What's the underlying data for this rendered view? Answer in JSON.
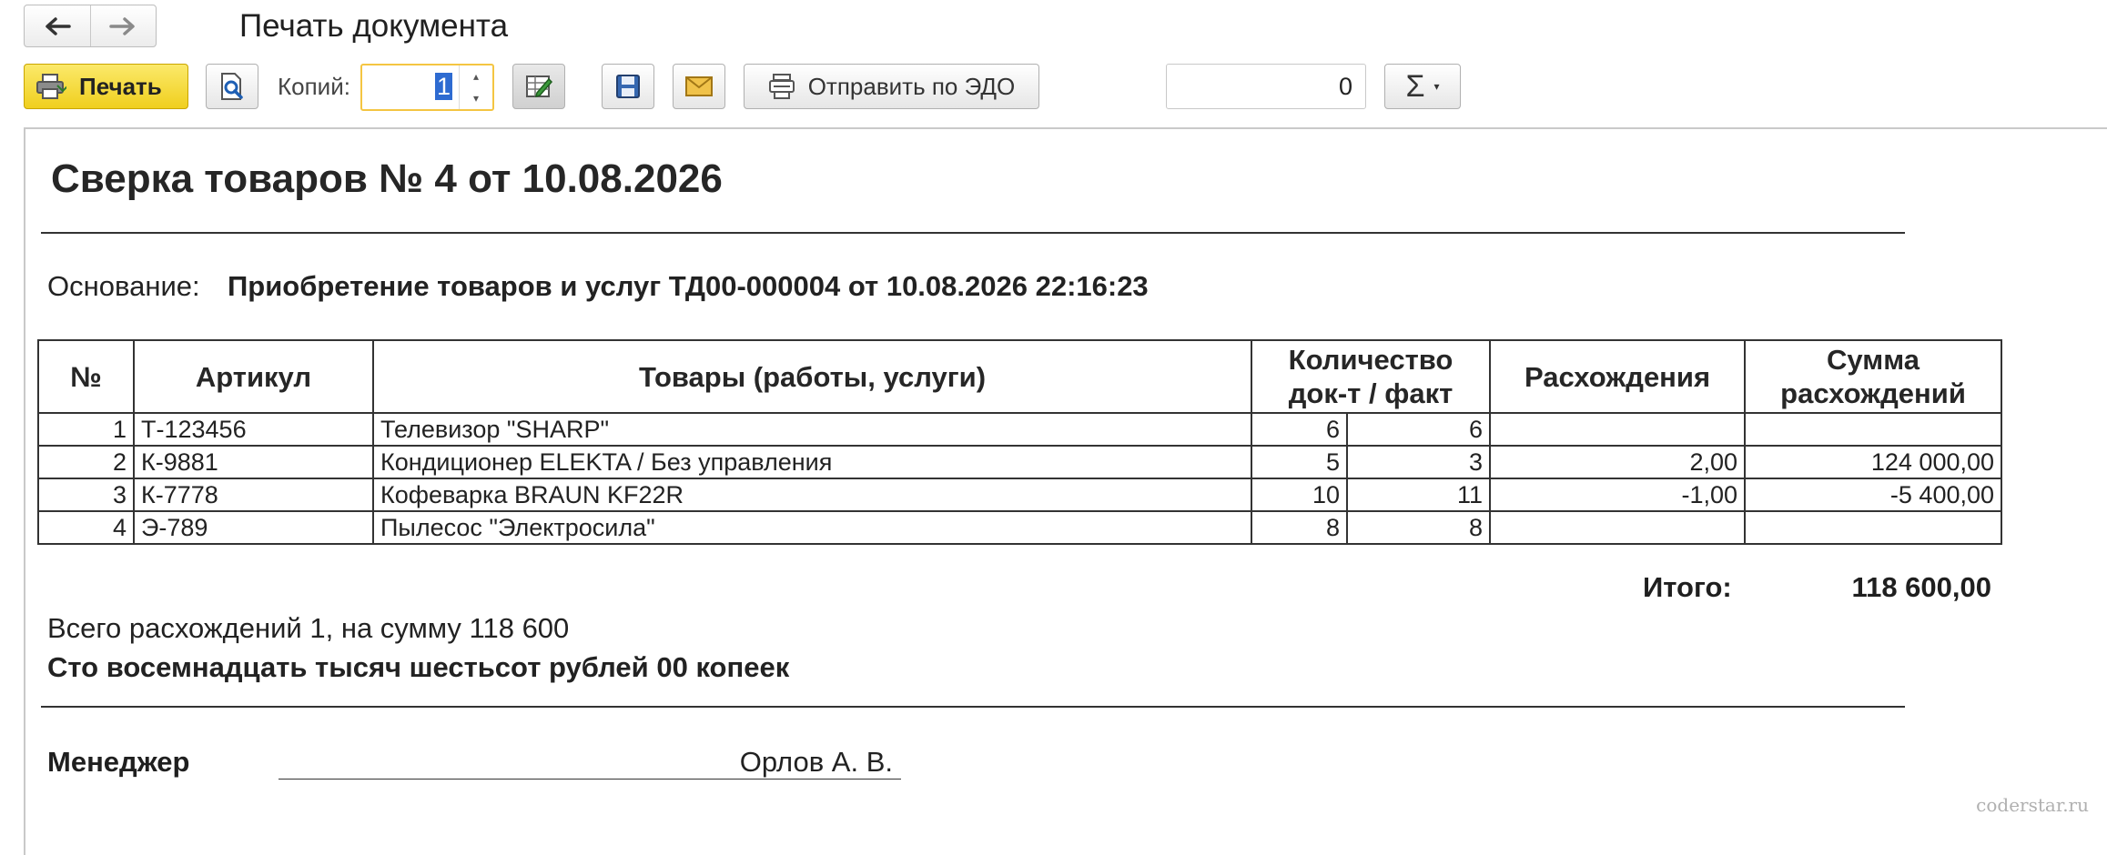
{
  "window": {
    "title": "Печать документа"
  },
  "toolbar": {
    "print_label": "Печать",
    "copies_label": "Копий:",
    "copies_value": "1",
    "send_edo_label": "Отправить по ЭДО",
    "sum_value": "0",
    "sigma_symbol": "Σ",
    "print_color": "#f5d62c"
  },
  "document": {
    "title": "Сверка товаров № 4 от 10.08.2026",
    "basis_label": "Основание:",
    "basis_value": "Приобретение товаров и услуг ТД00-000004 от 10.08.2026 22:16:23",
    "table": {
      "headers": {
        "num": "№",
        "article": "Артикул",
        "goods": "Товары (работы, услуги)",
        "qty_line1": "Количество",
        "qty_line2": "док-т / факт",
        "discrepancy": "Расхождения",
        "sum_line1": "Сумма",
        "sum_line2": "расхождений"
      },
      "rows": [
        {
          "num": "1",
          "article": "Т-123456",
          "name": "Телевизор \"SHARP\"",
          "qty_doc": "6",
          "qty_fact": "6",
          "discrepancy": "",
          "sum": ""
        },
        {
          "num": "2",
          "article": "К-9881",
          "name": "Кондиционер ELEKTA / Без управления",
          "qty_doc": "5",
          "qty_fact": "3",
          "discrepancy": "2,00",
          "sum": "124 000,00"
        },
        {
          "num": "3",
          "article": "К-7778",
          "name": "Кофеварка BRAUN KF22R",
          "qty_doc": "10",
          "qty_fact": "11",
          "discrepancy": "-1,00",
          "sum": "-5 400,00"
        },
        {
          "num": "4",
          "article": "Э-789",
          "name": "Пылесос \"Электросила\"",
          "qty_doc": "8",
          "qty_fact": "8",
          "discrepancy": "",
          "sum": ""
        }
      ]
    },
    "total_label": "Итого:",
    "total_value": "118 600,00",
    "summary": "Всего расхождений 1, на сумму 118 600",
    "amount_in_words": "Сто восемнадцать тысяч шестьсот рублей 00 копеек",
    "manager_label": "Менеджер",
    "manager_name": "Орлов А. В."
  },
  "watermark": "coderstar.ru"
}
